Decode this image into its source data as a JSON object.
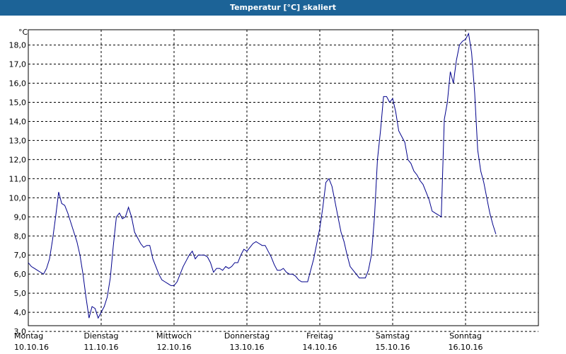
{
  "title": "Temperatur [°C] skaliert",
  "chart_data": {
    "type": "line",
    "title": "Temperatur [°C] skaliert",
    "unit": "°C",
    "ylim": [
      3.3,
      18.8
    ],
    "yticks": [
      "3,0",
      "4,0",
      "5,0",
      "6,0",
      "7,0",
      "8,0",
      "9,0",
      "10,0",
      "11,0",
      "12,0",
      "13,0",
      "14,0",
      "15,0",
      "16,0",
      "17,0",
      "18,0"
    ],
    "ytick_values": [
      3,
      4,
      5,
      6,
      7,
      8,
      9,
      10,
      11,
      12,
      13,
      14,
      15,
      16,
      17,
      18
    ],
    "days": [
      {
        "weekday": "Montag",
        "date": "10.10.16"
      },
      {
        "weekday": "Dienstag",
        "date": "11.10.16"
      },
      {
        "weekday": "Mittwoch",
        "date": "12.10.16"
      },
      {
        "weekday": "Donnerstag",
        "date": "13.10.16"
      },
      {
        "weekday": "Freitag",
        "date": "14.10.16"
      },
      {
        "weekday": "Samstag",
        "date": "15.10.16"
      },
      {
        "weekday": "Sonntag",
        "date": "16.10.16"
      }
    ],
    "grid": true,
    "line_color": "#00008b",
    "hours": [
      0,
      1,
      2,
      3,
      4,
      5,
      6,
      7,
      8,
      9,
      10,
      11,
      12,
      13,
      14,
      15,
      16,
      17,
      18,
      19,
      20,
      21,
      22,
      23,
      24,
      25,
      26,
      27,
      28,
      29,
      30,
      31,
      32,
      33,
      34,
      35,
      36,
      37,
      38,
      39,
      40,
      41,
      42,
      43,
      44,
      45,
      46,
      47,
      48,
      49,
      50,
      51,
      52,
      53,
      54,
      55,
      56,
      57,
      58,
      59,
      60,
      61,
      62,
      63,
      64,
      65,
      66,
      67,
      68,
      69,
      70,
      71,
      72,
      73,
      74,
      75,
      76,
      77,
      78,
      79,
      80,
      81,
      82,
      83,
      84,
      85,
      86,
      87,
      88,
      89,
      90,
      91,
      92,
      93,
      94,
      95,
      96,
      97,
      98,
      99,
      100,
      101,
      102,
      103,
      104,
      105,
      106,
      107,
      108,
      109,
      110,
      111,
      112,
      113,
      114,
      115,
      116,
      117,
      118,
      119,
      120,
      121,
      122,
      123,
      124,
      125,
      126,
      127,
      128,
      129,
      130,
      131,
      132,
      133,
      134,
      135,
      136,
      137,
      138,
      139,
      140,
      141,
      142,
      143,
      144,
      145,
      146,
      147,
      148,
      149,
      150,
      151,
      152,
      153,
      154,
      155,
      156,
      157,
      158,
      159,
      160,
      161,
      162,
      163,
      164,
      165,
      166,
      167,
      168
    ],
    "values": [
      6.6,
      6.4,
      6.3,
      6.2,
      6.1,
      6.0,
      6.3,
      6.8,
      7.8,
      9.0,
      10.3,
      9.7,
      9.6,
      9.2,
      8.7,
      8.2,
      7.7,
      7.0,
      6.0,
      4.8,
      3.7,
      4.3,
      4.2,
      3.7,
      4.0,
      4.3,
      4.8,
      5.8,
      7.5,
      9.0,
      9.2,
      8.9,
      9.0,
      9.5,
      9.0,
      8.2,
      7.9,
      7.6,
      7.4,
      7.5,
      7.5,
      6.8,
      6.4,
      6.0,
      5.7,
      5.6,
      5.5,
      5.4,
      5.4,
      5.6,
      6.0,
      6.4,
      6.7,
      7.0,
      7.2,
      6.8,
      7.0,
      7.0,
      7.0,
      6.9,
      6.6,
      6.1,
      6.3,
      6.3,
      6.2,
      6.4,
      6.3,
      6.4,
      6.6,
      6.6,
      7.0,
      7.3,
      7.2,
      7.4,
      7.6,
      7.7,
      7.6,
      7.5,
      7.5,
      7.2,
      6.9,
      6.5,
      6.2,
      6.2,
      6.3,
      6.1,
      6.0,
      6.0,
      5.9,
      5.7,
      5.6,
      5.6,
      5.6,
      6.2,
      6.8,
      7.6,
      8.4,
      9.5,
      10.8,
      11.0,
      10.6,
      9.8,
      9.0,
      8.2,
      7.7,
      7.0,
      6.4,
      6.2,
      6.0,
      5.8,
      5.8,
      5.8,
      6.2,
      7.0,
      9.0,
      12.0,
      13.5,
      15.3,
      15.3,
      15.0,
      15.2,
      14.5,
      13.5,
      13.2,
      12.9,
      12.0,
      11.8,
      11.4,
      11.2,
      10.9,
      10.7,
      10.3,
      9.9,
      9.3,
      9.2,
      9.1,
      9.0,
      14.1,
      15.0,
      16.6,
      16.0,
      17.2,
      18.0,
      18.2,
      18.3,
      18.6,
      17.6,
      15.5,
      12.5,
      11.4,
      10.8,
      10.0,
      9.2,
      8.6,
      8.1
    ]
  }
}
